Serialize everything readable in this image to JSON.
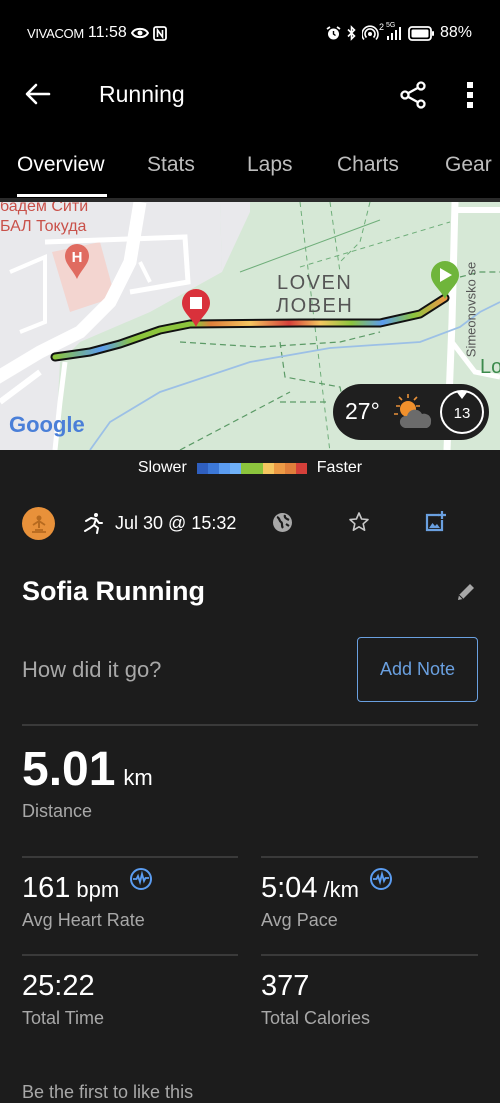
{
  "status_bar": {
    "carrier": "VIVACOM",
    "time": "11:58",
    "battery": "88%",
    "network": "5G",
    "hotspot_count": "2"
  },
  "app_bar": {
    "title": "Running"
  },
  "tabs": [
    {
      "label": "Overview",
      "active": true
    },
    {
      "label": "Stats",
      "active": false
    },
    {
      "label": "Laps",
      "active": false
    },
    {
      "label": "Charts",
      "active": false
    },
    {
      "label": "Gear",
      "active": false
    }
  ],
  "map": {
    "labels": {
      "poi_line1": "бадем Сити",
      "poi_line2": "БАЛ Токуда",
      "park_latin": "LOVEN",
      "park_cyrillic": "ЛОВЕН",
      "street": "Simeonovsko se",
      "edge_label": "Lo",
      "attribution": "Google"
    },
    "weather": {
      "temperature": "27°",
      "condition": "partly-cloudy-icon",
      "wind_speed": "13"
    }
  },
  "legend": {
    "left_label": "Slower",
    "right_label": "Faster",
    "colors": [
      "#2f5fbf",
      "#3c78d8",
      "#5b9cf0",
      "#6fb0f7",
      "#8cc43d",
      "#8cc43d",
      "#f5c660",
      "#ec9a45",
      "#e07f3b",
      "#d5403a"
    ]
  },
  "activity": {
    "type_icon": "running-icon",
    "date_time": "Jul 30 @ 15:32",
    "name": "Sofia Running",
    "note_prompt": "How did it go?",
    "add_note_label": "Add Note"
  },
  "stats": {
    "distance": {
      "value": "5.01",
      "unit": "km",
      "label": "Distance"
    },
    "avg_heart_rate": {
      "value": "161",
      "unit": "bpm",
      "label": "Avg Heart Rate"
    },
    "avg_pace": {
      "value": "5:04",
      "unit": "/km",
      "label": "Avg Pace"
    },
    "total_time": {
      "value": "25:22",
      "label": "Total Time"
    },
    "total_calories": {
      "value": "377",
      "label": "Total Calories"
    }
  },
  "footer": {
    "likes_text": "Be the first to like this"
  }
}
